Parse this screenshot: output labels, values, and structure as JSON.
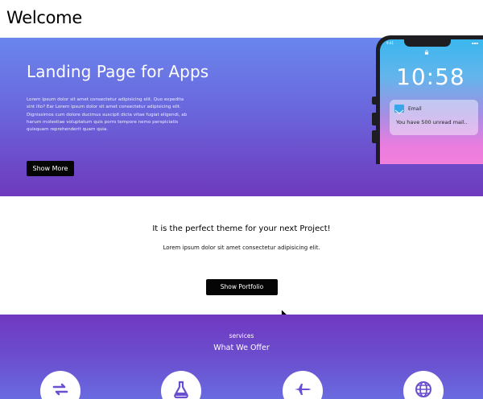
{
  "header": {
    "title": "Welcome"
  },
  "hero": {
    "title": "Landing Page for Apps",
    "body": "Lorem ipsum dolor sit amet consectetur adipisicing elit. Quo expedita sint illo? Ear Lorem ipsum dolor sit amet consectetur adipisicing elit. Dignissimos cum dolore ducimus suscipit dicta vitae fugiat eligendi, ab harum molestiae voluptatum quis porro tempore nemo perspiciatis quisquam reprehenderit quam quia.",
    "button_label": "Show More"
  },
  "phone": {
    "status_time": "9:41",
    "status_right": "▪▪▪",
    "clock": "10:58",
    "notification": {
      "app": "Email",
      "message": "You have 500 unread mail.."
    }
  },
  "project": {
    "heading": "It is the perfect theme for your next Project!",
    "text": "Lorem ipsum dolor sit amet consectetur adipisicing elit.",
    "button_label": "Show Portfolio"
  },
  "services": {
    "eyebrow": "services",
    "heading": "What We Offer",
    "icons": [
      "refresh-icon",
      "flask-icon",
      "plane-icon",
      "globe-icon"
    ],
    "icon_color": "#6a4fd0"
  },
  "colors": {
    "hero_top": "#6a86ee",
    "hero_bottom": "#6e39bd",
    "button": "#050505",
    "services_top": "#7138c0",
    "services_bottom": "#6a6be0"
  }
}
